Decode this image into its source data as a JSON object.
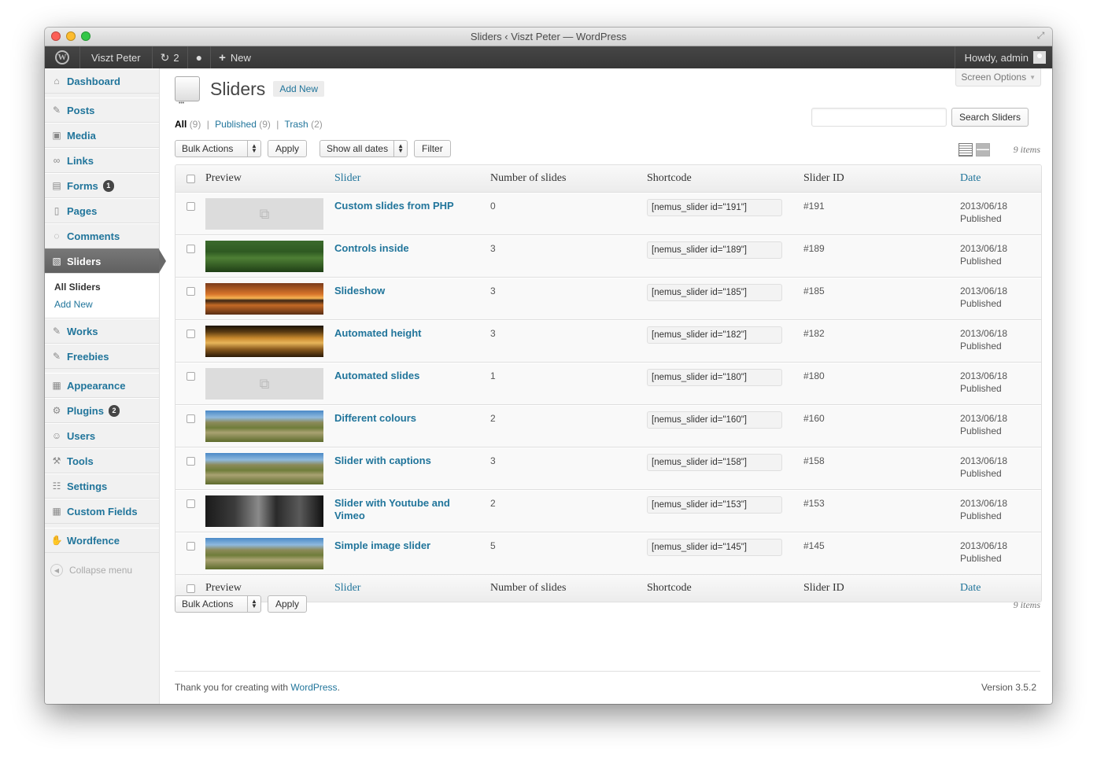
{
  "window": {
    "title": "Sliders ‹ Viszt Peter — WordPress"
  },
  "adminbar": {
    "site_name": "Viszt Peter",
    "updates_count": "2",
    "new_label": "New",
    "howdy": "Howdy, admin"
  },
  "sidebar": {
    "items": [
      {
        "label": "Dashboard",
        "icon": "dashboard-icon",
        "glyph": "⌂"
      },
      {
        "label": "Posts",
        "icon": "pushpin-icon",
        "glyph": "✎"
      },
      {
        "label": "Media",
        "icon": "media-icon",
        "glyph": "▣"
      },
      {
        "label": "Links",
        "icon": "link-icon",
        "glyph": "∞"
      },
      {
        "label": "Forms",
        "icon": "forms-icon",
        "glyph": "▤",
        "badge": "1"
      },
      {
        "label": "Pages",
        "icon": "pages-icon",
        "glyph": "▯"
      },
      {
        "label": "Comments",
        "icon": "comment-icon",
        "glyph": "◌"
      },
      {
        "label": "Sliders",
        "icon": "sliders-icon",
        "glyph": "▧"
      },
      {
        "label": "Works",
        "icon": "pushpin-icon",
        "glyph": "✎"
      },
      {
        "label": "Freebies",
        "icon": "pushpin-icon",
        "glyph": "✎"
      },
      {
        "label": "Appearance",
        "icon": "appearance-icon",
        "glyph": "▦"
      },
      {
        "label": "Plugins",
        "icon": "plugin-icon",
        "glyph": "⚙",
        "badge": "2"
      },
      {
        "label": "Users",
        "icon": "users-icon",
        "glyph": "☺"
      },
      {
        "label": "Tools",
        "icon": "tools-icon",
        "glyph": "⚒"
      },
      {
        "label": "Settings",
        "icon": "settings-icon",
        "glyph": "☷"
      },
      {
        "label": "Custom Fields",
        "icon": "custom-fields-icon",
        "glyph": "▦"
      },
      {
        "label": "Wordfence",
        "icon": "wordfence-icon",
        "glyph": "✋"
      }
    ],
    "submenu": {
      "all": "All Sliders",
      "add_new": "Add New"
    },
    "collapse": "Collapse menu"
  },
  "header": {
    "screen_options": "Screen Options",
    "title": "Sliders",
    "add_new": "Add New"
  },
  "views": {
    "all": "All",
    "all_count": "(9)",
    "published": "Published",
    "published_count": "(9)",
    "trash": "Trash",
    "trash_count": "(2)"
  },
  "search": {
    "button": "Search Sliders",
    "value": ""
  },
  "tablenav": {
    "bulk_actions": "Bulk Actions",
    "apply": "Apply",
    "dates": "Show all dates",
    "filter": "Filter",
    "items": "9 items"
  },
  "table": {
    "columns": {
      "preview": "Preview",
      "slider": "Slider",
      "num": "Number of slides",
      "shortcode": "Shortcode",
      "id": "Slider ID",
      "date": "Date"
    },
    "rows": [
      {
        "title": "Custom slides from PHP",
        "num": "0",
        "shortcode": "[nemus_slider id=\"191\"]",
        "id": "#191",
        "date": "2013/06/18",
        "status": "Published",
        "thumb": "empty"
      },
      {
        "title": "Controls inside",
        "num": "3",
        "shortcode": "[nemus_slider id=\"189\"]",
        "id": "#189",
        "date": "2013/06/18",
        "status": "Published",
        "thumb": "forest"
      },
      {
        "title": "Slideshow",
        "num": "3",
        "shortcode": "[nemus_slider id=\"185\"]",
        "id": "#185",
        "date": "2013/06/18",
        "status": "Published",
        "thumb": "sunset"
      },
      {
        "title": "Automated height",
        "num": "3",
        "shortcode": "[nemus_slider id=\"182\"]",
        "id": "#182",
        "date": "2013/06/18",
        "status": "Published",
        "thumb": "parliament"
      },
      {
        "title": "Automated slides",
        "num": "1",
        "shortcode": "[nemus_slider id=\"180\"]",
        "id": "#180",
        "date": "2013/06/18",
        "status": "Published",
        "thumb": "empty"
      },
      {
        "title": "Different colours",
        "num": "2",
        "shortcode": "[nemus_slider id=\"160\"]",
        "id": "#160",
        "date": "2013/06/18",
        "status": "Published",
        "thumb": "mountain"
      },
      {
        "title": "Slider with captions",
        "num": "3",
        "shortcode": "[nemus_slider id=\"158\"]",
        "id": "#158",
        "date": "2013/06/18",
        "status": "Published",
        "thumb": "mountain"
      },
      {
        "title": "Slider with Youtube and Vimeo",
        "num": "2",
        "shortcode": "[nemus_slider id=\"153\"]",
        "id": "#153",
        "date": "2013/06/18",
        "status": "Published",
        "thumb": "portrait"
      },
      {
        "title": "Simple image slider",
        "num": "5",
        "shortcode": "[nemus_slider id=\"145\"]",
        "id": "#145",
        "date": "2013/06/18",
        "status": "Published",
        "thumb": "mountain"
      }
    ]
  },
  "footer": {
    "thanks": "Thank you for creating with",
    "wordpress": "WordPress",
    "version": "Version 3.5.2"
  },
  "colors": {
    "link": "#21759b",
    "adminbar": "#464646",
    "current_menu": "#6a6a6a"
  }
}
